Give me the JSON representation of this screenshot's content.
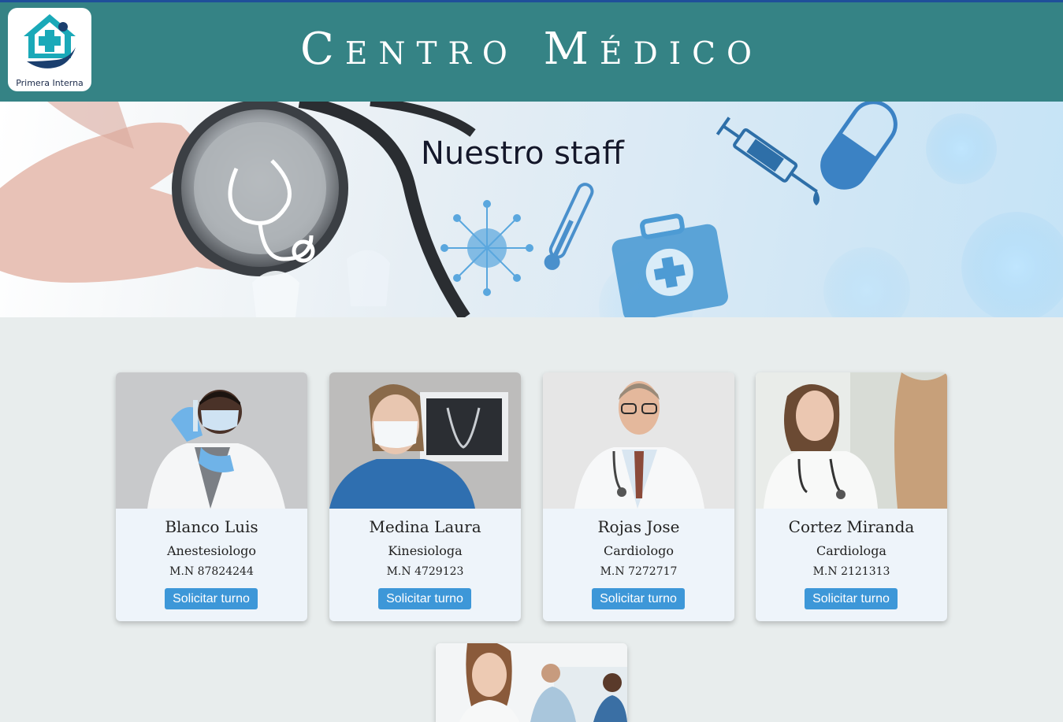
{
  "header": {
    "title": "Centro Médico",
    "logo_text": "Primera Interna",
    "bg_color": "#358385"
  },
  "hero": {
    "title": "Nuestro staff"
  },
  "doctors": [
    {
      "name": "Blanco Luis",
      "specialty": "Anestesiologo",
      "license": "M.N 87824244",
      "button": "Solicitar turno"
    },
    {
      "name": "Medina Laura",
      "specialty": "Kinesiologa",
      "license": "M.N 4729123",
      "button": "Solicitar turno"
    },
    {
      "name": "Rojas Jose",
      "specialty": "Cardiologo",
      "license": "M.N 7272717",
      "button": "Solicitar turno"
    },
    {
      "name": "Cortez Miranda",
      "specialty": "Cardiologa",
      "license": "M.N 2121313",
      "button": "Solicitar turno"
    }
  ],
  "colors": {
    "accent_button": "#3d97d8",
    "page_bg": "#e8eded",
    "card_bg": "#eef4fa"
  }
}
